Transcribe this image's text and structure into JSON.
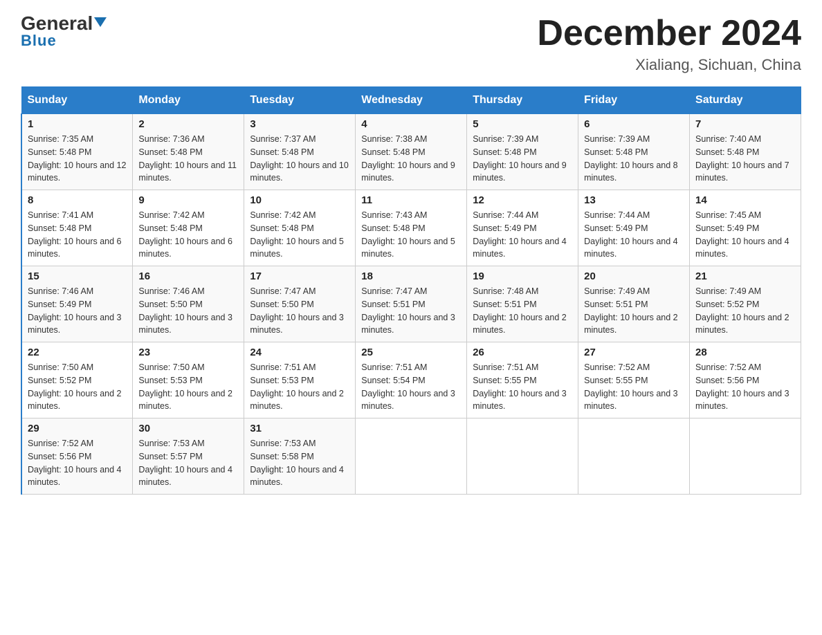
{
  "logo": {
    "general": "General",
    "blue": "Blue",
    "triangle": "▼"
  },
  "title": "December 2024",
  "subtitle": "Xialiang, Sichuan, China",
  "headers": [
    "Sunday",
    "Monday",
    "Tuesday",
    "Wednesday",
    "Thursday",
    "Friday",
    "Saturday"
  ],
  "weeks": [
    [
      {
        "day": "1",
        "sunrise": "7:35 AM",
        "sunset": "5:48 PM",
        "daylight": "10 hours and 12 minutes."
      },
      {
        "day": "2",
        "sunrise": "7:36 AM",
        "sunset": "5:48 PM",
        "daylight": "10 hours and 11 minutes."
      },
      {
        "day": "3",
        "sunrise": "7:37 AM",
        "sunset": "5:48 PM",
        "daylight": "10 hours and 10 minutes."
      },
      {
        "day": "4",
        "sunrise": "7:38 AM",
        "sunset": "5:48 PM",
        "daylight": "10 hours and 9 minutes."
      },
      {
        "day": "5",
        "sunrise": "7:39 AM",
        "sunset": "5:48 PM",
        "daylight": "10 hours and 9 minutes."
      },
      {
        "day": "6",
        "sunrise": "7:39 AM",
        "sunset": "5:48 PM",
        "daylight": "10 hours and 8 minutes."
      },
      {
        "day": "7",
        "sunrise": "7:40 AM",
        "sunset": "5:48 PM",
        "daylight": "10 hours and 7 minutes."
      }
    ],
    [
      {
        "day": "8",
        "sunrise": "7:41 AM",
        "sunset": "5:48 PM",
        "daylight": "10 hours and 6 minutes."
      },
      {
        "day": "9",
        "sunrise": "7:42 AM",
        "sunset": "5:48 PM",
        "daylight": "10 hours and 6 minutes."
      },
      {
        "day": "10",
        "sunrise": "7:42 AM",
        "sunset": "5:48 PM",
        "daylight": "10 hours and 5 minutes."
      },
      {
        "day": "11",
        "sunrise": "7:43 AM",
        "sunset": "5:48 PM",
        "daylight": "10 hours and 5 minutes."
      },
      {
        "day": "12",
        "sunrise": "7:44 AM",
        "sunset": "5:49 PM",
        "daylight": "10 hours and 4 minutes."
      },
      {
        "day": "13",
        "sunrise": "7:44 AM",
        "sunset": "5:49 PM",
        "daylight": "10 hours and 4 minutes."
      },
      {
        "day": "14",
        "sunrise": "7:45 AM",
        "sunset": "5:49 PM",
        "daylight": "10 hours and 4 minutes."
      }
    ],
    [
      {
        "day": "15",
        "sunrise": "7:46 AM",
        "sunset": "5:49 PM",
        "daylight": "10 hours and 3 minutes."
      },
      {
        "day": "16",
        "sunrise": "7:46 AM",
        "sunset": "5:50 PM",
        "daylight": "10 hours and 3 minutes."
      },
      {
        "day": "17",
        "sunrise": "7:47 AM",
        "sunset": "5:50 PM",
        "daylight": "10 hours and 3 minutes."
      },
      {
        "day": "18",
        "sunrise": "7:47 AM",
        "sunset": "5:51 PM",
        "daylight": "10 hours and 3 minutes."
      },
      {
        "day": "19",
        "sunrise": "7:48 AM",
        "sunset": "5:51 PM",
        "daylight": "10 hours and 2 minutes."
      },
      {
        "day": "20",
        "sunrise": "7:49 AM",
        "sunset": "5:51 PM",
        "daylight": "10 hours and 2 minutes."
      },
      {
        "day": "21",
        "sunrise": "7:49 AM",
        "sunset": "5:52 PM",
        "daylight": "10 hours and 2 minutes."
      }
    ],
    [
      {
        "day": "22",
        "sunrise": "7:50 AM",
        "sunset": "5:52 PM",
        "daylight": "10 hours and 2 minutes."
      },
      {
        "day": "23",
        "sunrise": "7:50 AM",
        "sunset": "5:53 PM",
        "daylight": "10 hours and 2 minutes."
      },
      {
        "day": "24",
        "sunrise": "7:51 AM",
        "sunset": "5:53 PM",
        "daylight": "10 hours and 2 minutes."
      },
      {
        "day": "25",
        "sunrise": "7:51 AM",
        "sunset": "5:54 PM",
        "daylight": "10 hours and 3 minutes."
      },
      {
        "day": "26",
        "sunrise": "7:51 AM",
        "sunset": "5:55 PM",
        "daylight": "10 hours and 3 minutes."
      },
      {
        "day": "27",
        "sunrise": "7:52 AM",
        "sunset": "5:55 PM",
        "daylight": "10 hours and 3 minutes."
      },
      {
        "day": "28",
        "sunrise": "7:52 AM",
        "sunset": "5:56 PM",
        "daylight": "10 hours and 3 minutes."
      }
    ],
    [
      {
        "day": "29",
        "sunrise": "7:52 AM",
        "sunset": "5:56 PM",
        "daylight": "10 hours and 4 minutes."
      },
      {
        "day": "30",
        "sunrise": "7:53 AM",
        "sunset": "5:57 PM",
        "daylight": "10 hours and 4 minutes."
      },
      {
        "day": "31",
        "sunrise": "7:53 AM",
        "sunset": "5:58 PM",
        "daylight": "10 hours and 4 minutes."
      },
      null,
      null,
      null,
      null
    ]
  ]
}
